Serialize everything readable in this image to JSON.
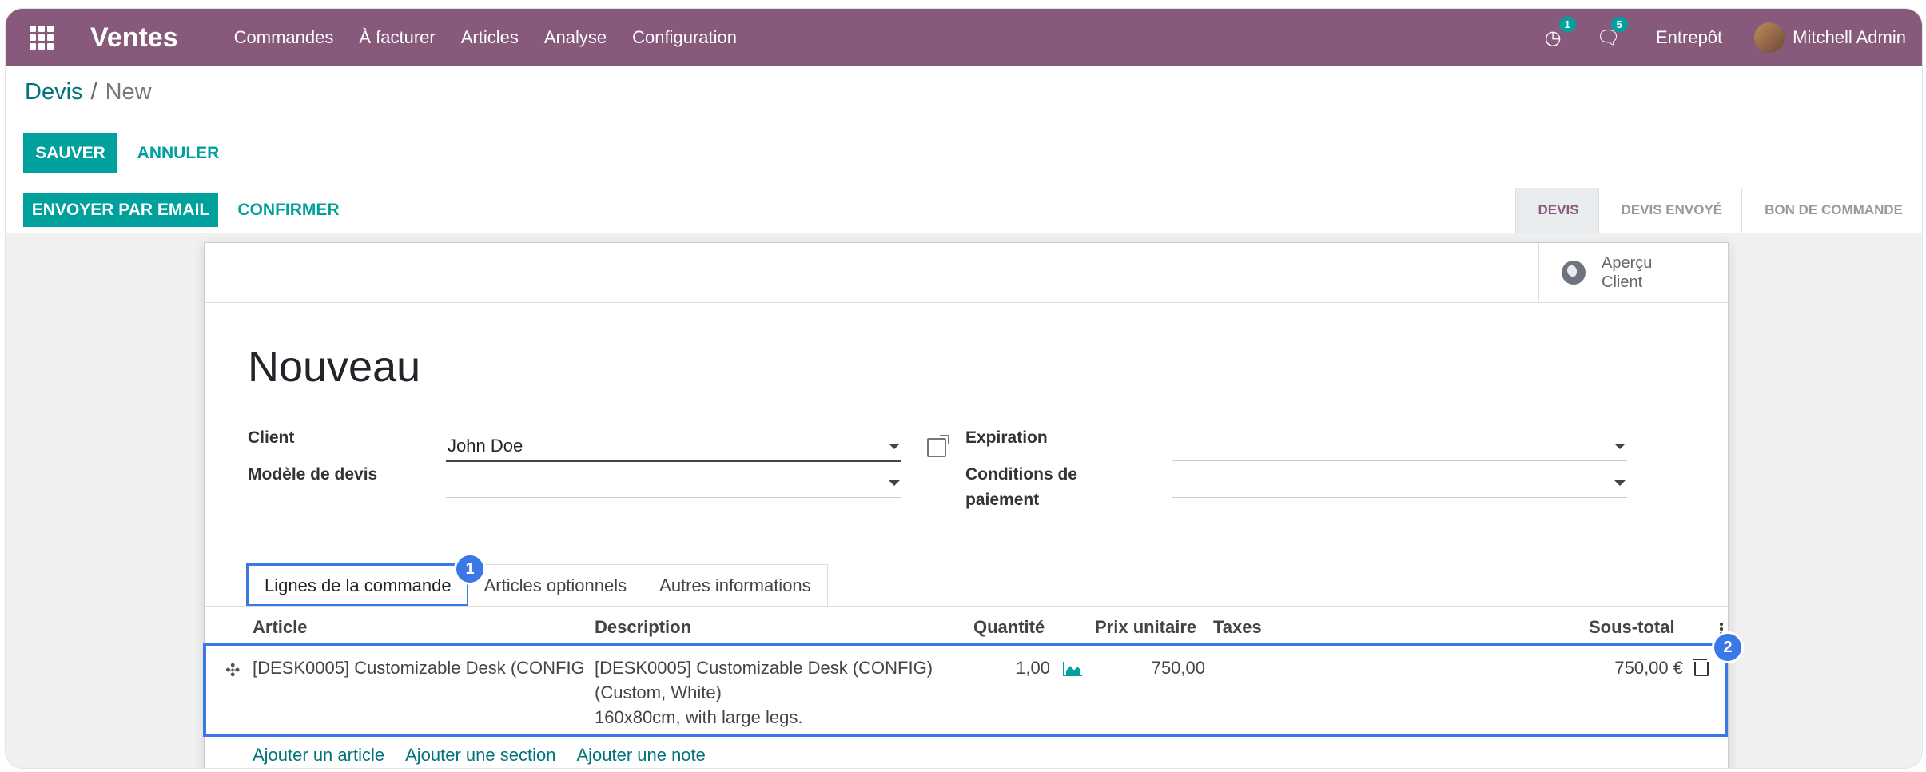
{
  "navbar": {
    "app_title": "Ventes",
    "menu": [
      "Commandes",
      "À facturer",
      "Articles",
      "Analyse",
      "Configuration"
    ],
    "activity_count": "1",
    "messages_count": "5",
    "company": "Entrepôt",
    "user": "Mitchell Admin"
  },
  "breadcrumb": {
    "parent": "Devis",
    "separator": "/",
    "current": "New"
  },
  "buttons": {
    "save": "SAUVER",
    "discard": "ANNULER",
    "send_email": "ENVOYER PAR EMAIL",
    "confirm": "CONFIRMER"
  },
  "stages": [
    "DEVIS",
    "DEVIS ENVOYÉ",
    "BON DE COMMANDE"
  ],
  "sheet": {
    "preview": "Aperçu Client",
    "title": "Nouveau",
    "fields": {
      "client_label": "Client",
      "client_value": "John Doe",
      "template_label": "Modèle de devis",
      "template_value": "",
      "expiration_label": "Expiration",
      "expiration_value": "",
      "payment_label": "Conditions de paiement",
      "payment_value": ""
    },
    "tabs": [
      "Lignes de la commande",
      "Articles optionnels",
      "Autres informations"
    ],
    "columns": {
      "article": "Article",
      "description": "Description",
      "quantity": "Quantité",
      "unit_price": "Prix unitaire",
      "taxes": "Taxes",
      "subtotal": "Sous-total"
    },
    "line": {
      "article": "[DESK0005] Customizable Desk (CONFIG…",
      "description_1": "[DESK0005] Customizable Desk (CONFIG)",
      "description_2": "(Custom, White)",
      "description_3": "160x80cm, with large legs.",
      "quantity": "1,00",
      "unit_price": "750,00",
      "taxes": "",
      "subtotal": "750,00 €"
    },
    "add_links": [
      "Ajouter un article",
      "Ajouter une section",
      "Ajouter une note"
    ]
  },
  "markers": [
    "1",
    "2"
  ],
  "colors": {
    "brand": "#875a7b",
    "primary": "#00a09d",
    "highlight": "#3b78e7"
  }
}
